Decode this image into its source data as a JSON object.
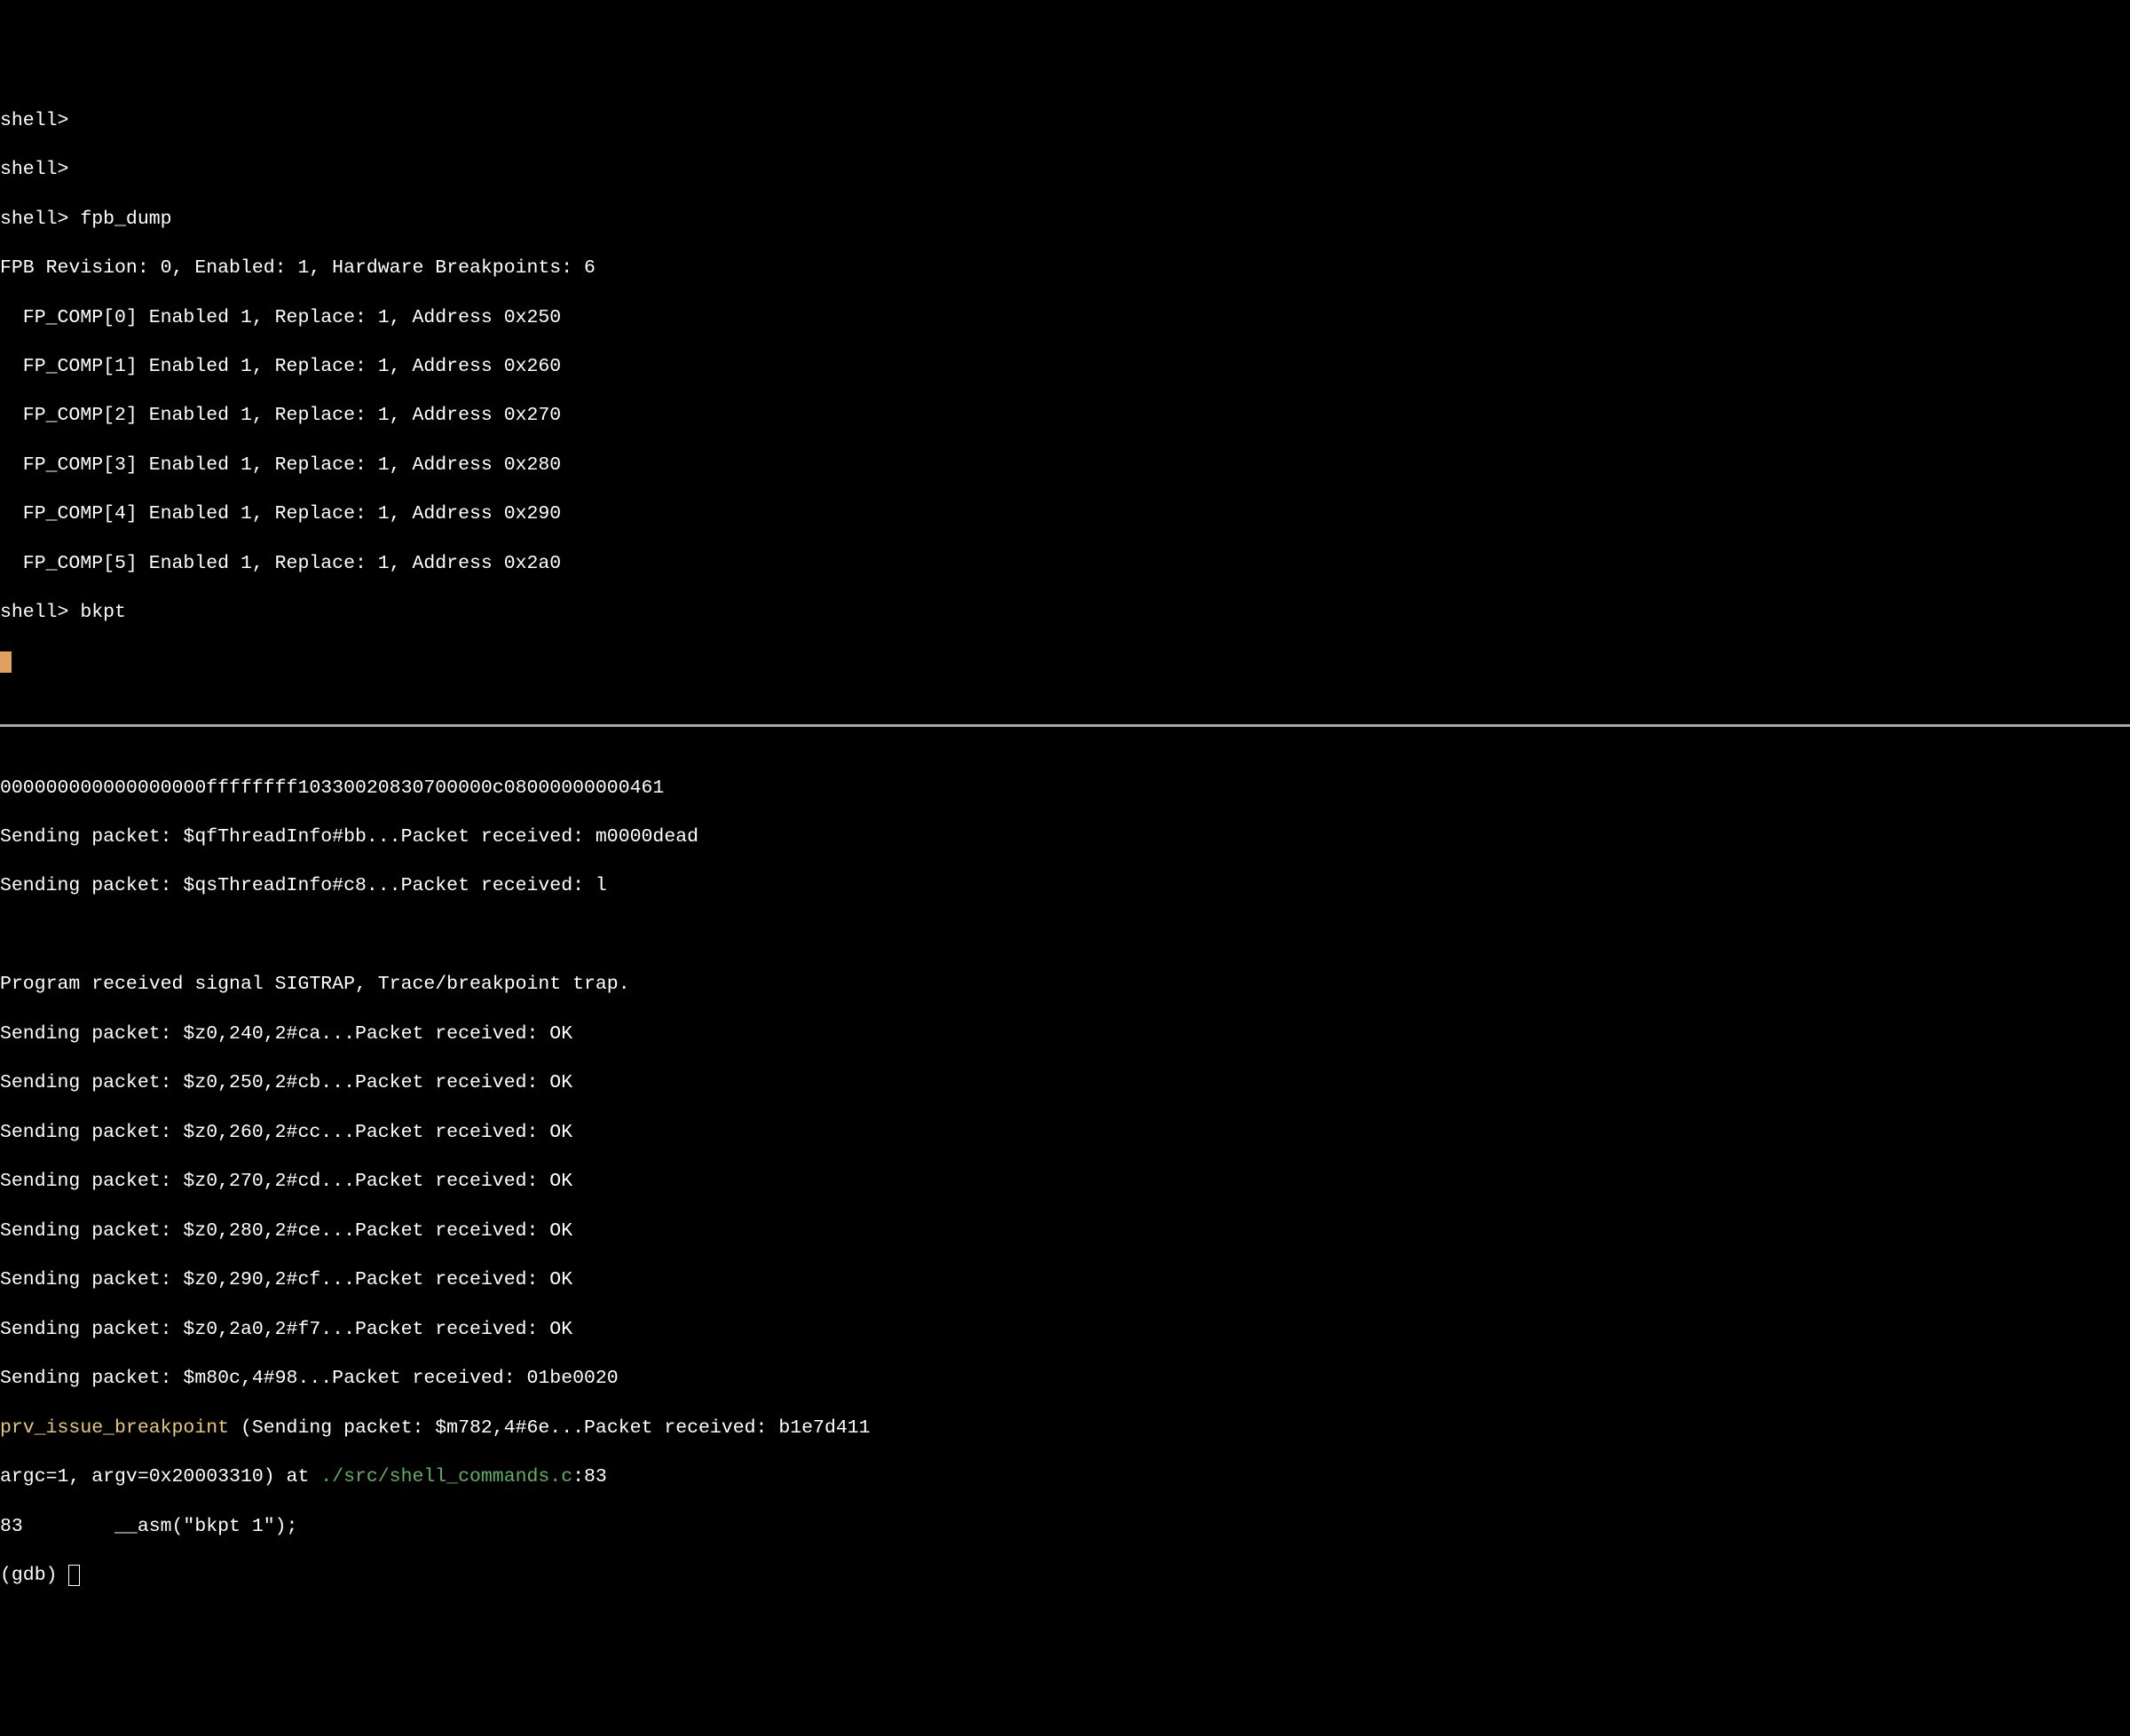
{
  "top": {
    "truncated": "shell>",
    "prompt1": "shell>",
    "prompt2": "shell> fpb_dump",
    "fpb_header": "FPB Revision: 0, Enabled: 1, Hardware Breakpoints: 6",
    "fp_comp": [
      "  FP_COMP[0] Enabled 1, Replace: 1, Address 0x250",
      "  FP_COMP[1] Enabled 1, Replace: 1, Address 0x260",
      "  FP_COMP[2] Enabled 1, Replace: 1, Address 0x270",
      "  FP_COMP[3] Enabled 1, Replace: 1, Address 0x280",
      "  FP_COMP[4] Enabled 1, Replace: 1, Address 0x290",
      "  FP_COMP[5] Enabled 1, Replace: 1, Address 0x2a0"
    ],
    "prompt3": "shell> bkpt"
  },
  "bottom": {
    "hex_line": "000000000000000000ffffffff10330020830700000c08000000000461",
    "packets_pre": [
      "Sending packet: $qfThreadInfo#bb...Packet received: m0000dead",
      "Sending packet: $qsThreadInfo#c8...Packet received: l"
    ],
    "sigtrap": "Program received signal SIGTRAP, Trace/breakpoint trap.",
    "packets_z": [
      "Sending packet: $z0,240,2#ca...Packet received: OK",
      "Sending packet: $z0,250,2#cb...Packet received: OK",
      "Sending packet: $z0,260,2#cc...Packet received: OK",
      "Sending packet: $z0,270,2#cd...Packet received: OK",
      "Sending packet: $z0,280,2#ce...Packet received: OK",
      "Sending packet: $z0,290,2#cf...Packet received: OK",
      "Sending packet: $z0,2a0,2#f7...Packet received: OK",
      "Sending packet: $m80c,4#98...Packet received: 01be0020"
    ],
    "fn_name": "prv_issue_breakpoint",
    "fn_tail": " (Sending packet: $m782,4#6e...Packet received: b1e7d411",
    "argc_pre": "argc=1, argv=0x20003310) at ",
    "path": "./src/shell_commands.c",
    "path_suffix": ":83",
    "src_line": "83        __asm(\"bkpt 1\");",
    "gdb_prompt": "(gdb) "
  }
}
